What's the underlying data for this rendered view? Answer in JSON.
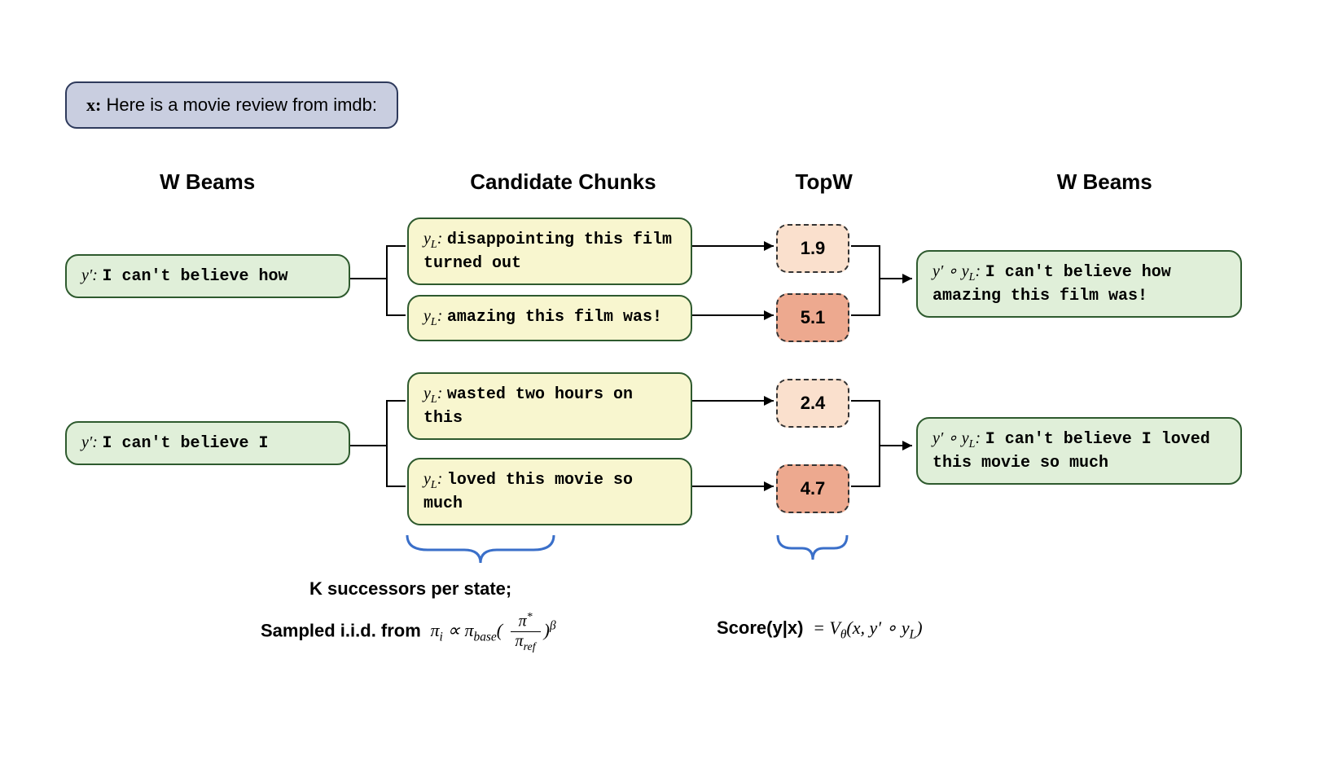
{
  "prompt": {
    "x_label": "x:",
    "text": "Here is a movie review from imdb:"
  },
  "headers": {
    "col1": "W Beams",
    "col2": "Candidate Chunks",
    "col3": "TopW",
    "col4": "W Beams"
  },
  "beams_in": [
    {
      "prefix": "y′:",
      "text": "I can't believe how"
    },
    {
      "prefix": "y′:",
      "text": "I can't believe I"
    }
  ],
  "chunks": [
    {
      "prefix": "yL:",
      "text": "disappointing this film turned out"
    },
    {
      "prefix": "yL:",
      "text": "amazing this film was!"
    },
    {
      "prefix": "yL:",
      "text": "wasted two hours on this"
    },
    {
      "prefix": "yL:",
      "text": "loved this movie so much"
    }
  ],
  "scores": [
    {
      "value": "1.9",
      "class": "score-low"
    },
    {
      "value": "5.1",
      "class": "score-high"
    },
    {
      "value": "2.4",
      "class": "score-low"
    },
    {
      "value": "4.7",
      "class": "score-high"
    }
  ],
  "beams_out": [
    {
      "prefix": "y′ ∘ yL:",
      "text": "I can't believe how amazing this film was!"
    },
    {
      "prefix": "y′ ∘ yL:",
      "text": "I can't believe I loved this movie so much"
    }
  ],
  "footer": {
    "line1": "K successors per state;",
    "line2_a": "Sampled i.i.d. from",
    "formula1": {
      "pi_i": "π",
      "prop": "∝",
      "pi_base": "π",
      "base_sub": "base",
      "lparen": "(",
      "num": "π*",
      "den_pi": "π",
      "den_sub": "ref",
      "rparen": ")",
      "beta": "β"
    },
    "score_label": "Score(y|x)",
    "eq": "=",
    "formula2": {
      "V": "V",
      "theta": "θ",
      "args": "(x, y′ ∘ y",
      "L": "L",
      "close": ")"
    }
  }
}
